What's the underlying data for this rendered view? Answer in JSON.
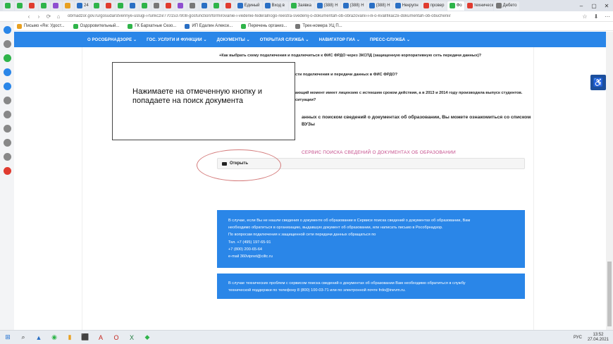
{
  "browser": {
    "tabs": [
      {
        "label": "",
        "color": "#2fb44a"
      },
      {
        "label": "",
        "color": "#2fb44a"
      },
      {
        "label": "",
        "color": "#e03b2f"
      },
      {
        "label": "",
        "color": "#2fb44a"
      },
      {
        "label": "",
        "color": "#8f4fd0"
      },
      {
        "label": "",
        "color": "#e8a020"
      },
      {
        "label": "24",
        "color": "#2a6fc4"
      },
      {
        "label": "",
        "color": "#2fb44a"
      },
      {
        "label": "",
        "color": "#e03b2f"
      },
      {
        "label": "",
        "color": "#2fb44a"
      },
      {
        "label": "",
        "color": "#2a6fc4"
      },
      {
        "label": "",
        "color": "#2fb44a"
      },
      {
        "label": "",
        "color": "#777777"
      },
      {
        "label": "",
        "color": "#e03b2f"
      },
      {
        "label": "",
        "color": "#8f4fd0"
      },
      {
        "label": "",
        "color": "#777777"
      },
      {
        "label": "",
        "color": "#2a6fc4"
      },
      {
        "label": "",
        "color": "#2fb44a"
      },
      {
        "label": "",
        "color": "#e03b2f"
      },
      {
        "label": "Единый",
        "color": "#2a6fc4"
      },
      {
        "label": "Вход в",
        "color": "#2a6fc4"
      },
      {
        "label": "Заявка",
        "color": "#2fb44a"
      },
      {
        "label": "(388) Н",
        "color": "#2a6fc4"
      },
      {
        "label": "(388) Н",
        "color": "#2a6fc4"
      },
      {
        "label": "(388) Н",
        "color": "#2a6fc4"
      },
      {
        "label": "Некрупн",
        "color": "#2a6fc4"
      },
      {
        "label": "провер",
        "color": "#e03b2f"
      },
      {
        "label": "Фо",
        "color": "#2fb44a",
        "active": true
      },
      {
        "label": "техническ",
        "color": "#e03b2f"
      },
      {
        "label": "Дебето",
        "color": "#777777"
      }
    ],
    "nav": {
      "back": "‹",
      "forward": "›",
      "reload": "⟳",
      "home": "⌂"
    },
    "url": "obrnadzor.gov.ru/gosudarstvennye-uslugi-i-funkczii/7701537808-gosfunction/formirovanie-i-vedenie-federalnogo-reestra-svedenij-o-dokumentah-ob-obrazovanii-i-ili-o-kvalifikaczii-dokumentah-ob-obuchenii/",
    "toolbar_icons": [
      "☆",
      "⬇",
      "⋯"
    ],
    "bookmarks": [
      {
        "label": "Письмо «Re: Удост...",
        "color": "#e8a020"
      },
      {
        "label": "Оздоровительный...",
        "color": "#2fb44a"
      },
      {
        "label": "ГК Бархатные Сезо...",
        "color": "#2fb44a"
      },
      {
        "label": "ИП Едалин Алексе...",
        "color": "#2a6fc4"
      },
      {
        "label": "Перечень организ...",
        "color": "#2fb44a"
      },
      {
        "label": "Трек-номера УЦ П...",
        "color": "#777777"
      }
    ],
    "sidebar_colors": [
      "#2a86e8",
      "#888888",
      "#2fb44a",
      "#2a86e8",
      "#2a86e8",
      "#888888",
      "#888888",
      "#888888",
      "#888888",
      "#888888",
      "#e03b2f"
    ]
  },
  "site": {
    "nav": [
      "О РОСОБРНАДЗОРЕ ⌄",
      "ГОС. УСЛУГИ И ФУНКЦИИ ⌄",
      "ДОКУМЕНТЫ ⌄",
      "ОТКРЫТАЯ СЛУЖБА ⌄",
      "НАВИГАТОР ГИА ⌄",
      "ПРЕСС-СЛУЖБА ⌄"
    ],
    "faq": {
      "q1": "+Как выбрать схему подключения и подключиться к ФИС ФРДО через ЗКСПД (защищенную корпоративную сеть передачи данных)?",
      "q2_tail": "сти подключения и передачи данных в ФИС ФРДО?",
      "q3_tail_a": "ающий момент имеет лицензию с истекшим сроком действия, а в 2013 и 2014 году производила выпуск студентов.",
      "q3_tail_b": "ситуации?"
    },
    "intro_tail_a": "анных с поиском сведений о документах об образовании, Вы можете ознакомиться со списком",
    "intro_tail_b": "ВУЗы",
    "service_title": "СЕРВИС ПОИСКА СВЕДЕНИЙ О ДОКУМЕНТАХ ОБ ОБРАЗОВАНИИ",
    "open_label": "Открыть",
    "info1": [
      "В случае, если Вы не нашли сведения о документе об образовании в Сервисе поиска сведений о документах об образовании, Вам",
      "необходимо обратиться в организацию, выдавшую документ об образовании, или написать письмо в Рособрнадзор.",
      "По вопросам подключения к защищенной сети передачи данных обращаться по",
      "Тел. +7 (495) 197-65-91",
      "+7 (800) 200-65-64",
      "e-mail 360vipnet@ciltc.ru"
    ],
    "info2": [
      "В случае технических проблем с сервисом поиска сведений о документах об образовании Вам необходимо обратиться в службу",
      "технической поддержки по телефону  8 (800) 100-03-71 или по электронной почте frdo@inevm.ru."
    ],
    "accessibility_icon": "♿"
  },
  "overlay": {
    "text": "Нажимаете на отмеченную кнопку и попадаете на поиск документа"
  },
  "taskbar": {
    "apps": [
      {
        "icon": "⊞",
        "color": "#1e6fd1"
      },
      {
        "icon": "⌕",
        "color": "#333333"
      },
      {
        "icon": "▲",
        "color": "#2a6fc4"
      },
      {
        "icon": "◉",
        "color": "#2fb44a"
      },
      {
        "icon": "▮",
        "color": "#e8a020"
      },
      {
        "icon": "⬛",
        "color": "#333333"
      },
      {
        "icon": "A",
        "color": "#c4261d"
      },
      {
        "icon": "O",
        "color": "#c4261d"
      },
      {
        "icon": "X",
        "color": "#1e7b3c"
      },
      {
        "icon": "◆",
        "color": "#2fb44a"
      }
    ],
    "lang": "РУС",
    "time": "13:52",
    "date": "27.04.2021"
  }
}
